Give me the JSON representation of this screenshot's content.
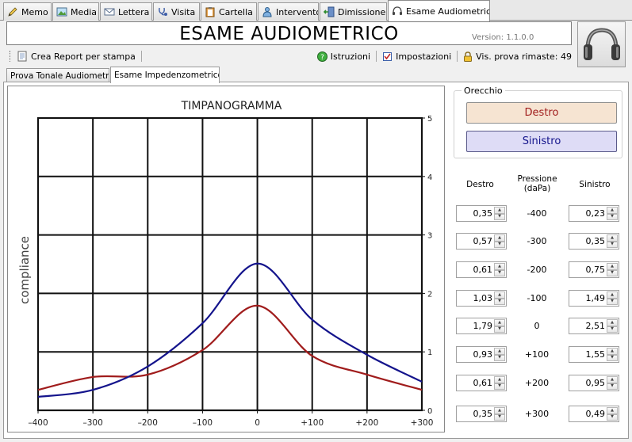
{
  "tabs": [
    {
      "label": "Memo",
      "icon": "pencil-icon"
    },
    {
      "label": "Media",
      "icon": "picture-icon"
    },
    {
      "label": "Lettera",
      "icon": "envelope-icon"
    },
    {
      "label": "Visita",
      "icon": "stethoscope-icon"
    },
    {
      "label": "Cartella",
      "icon": "clipboard-icon"
    },
    {
      "label": "Intervento",
      "icon": "doctor-icon"
    },
    {
      "label": "Dimissione",
      "icon": "exit-door-icon"
    },
    {
      "label": "Esame Audiometrico",
      "icon": "headphones-small-icon"
    }
  ],
  "header": {
    "title": "ESAME AUDIOMETRICO",
    "version": "Version: 1.1.0.0"
  },
  "toolbar": {
    "report": "Crea Report per stampa",
    "istruzioni": "Istruzioni",
    "impostazioni": "Impostazioni",
    "vis_prova": "Vis. prova rimaste: 49"
  },
  "subtabs": [
    "Prova Tonale Audiometria",
    "Esame Impedenzometrico"
  ],
  "ear": {
    "group_label": "Orecchio",
    "right": "Destro",
    "left": "Sinistro",
    "right_color": "#f6e4d2",
    "left_color": "#dedcf6"
  },
  "table": {
    "head_right": "Destro",
    "head_pressure": "Pressione\n(daPa)",
    "head_left": "Sinistro",
    "rows": [
      {
        "right": "0,35",
        "pressure": "-400",
        "left": "0,23"
      },
      {
        "right": "0,57",
        "pressure": "-300",
        "left": "0,35"
      },
      {
        "right": "0,61",
        "pressure": "-200",
        "left": "0,75"
      },
      {
        "right": "1,03",
        "pressure": "-100",
        "left": "1,49"
      },
      {
        "right": "1,79",
        "pressure": "0",
        "left": "2,51"
      },
      {
        "right": "0,93",
        "pressure": "+100",
        "left": "1,55"
      },
      {
        "right": "0,61",
        "pressure": "+200",
        "left": "0,95"
      },
      {
        "right": "0,35",
        "pressure": "+300",
        "left": "0,49"
      }
    ]
  },
  "chart_data": {
    "type": "line",
    "title": "TIMPANOGRAMMA",
    "ylabel": "compliance",
    "xlabel": "",
    "x": [
      -400,
      -300,
      -200,
      -100,
      0,
      100,
      200,
      300
    ],
    "x_tick_labels": [
      "–400",
      "–300",
      "–200",
      "–100",
      "0",
      "+100",
      "+200",
      "+300"
    ],
    "y_tick_labels": [
      "0",
      "1",
      "2",
      "3",
      "4",
      "5"
    ],
    "xlim": [
      -400,
      300
    ],
    "ylim": [
      0,
      5
    ],
    "grid": true,
    "series": [
      {
        "color": "#a01c1c",
        "values": [
          0.35,
          0.57,
          0.61,
          1.03,
          1.79,
          0.93,
          0.61,
          0.35
        ]
      },
      {
        "color": "#14148c",
        "values": [
          0.23,
          0.35,
          0.75,
          1.49,
          2.51,
          1.55,
          0.95,
          0.49
        ]
      }
    ]
  }
}
